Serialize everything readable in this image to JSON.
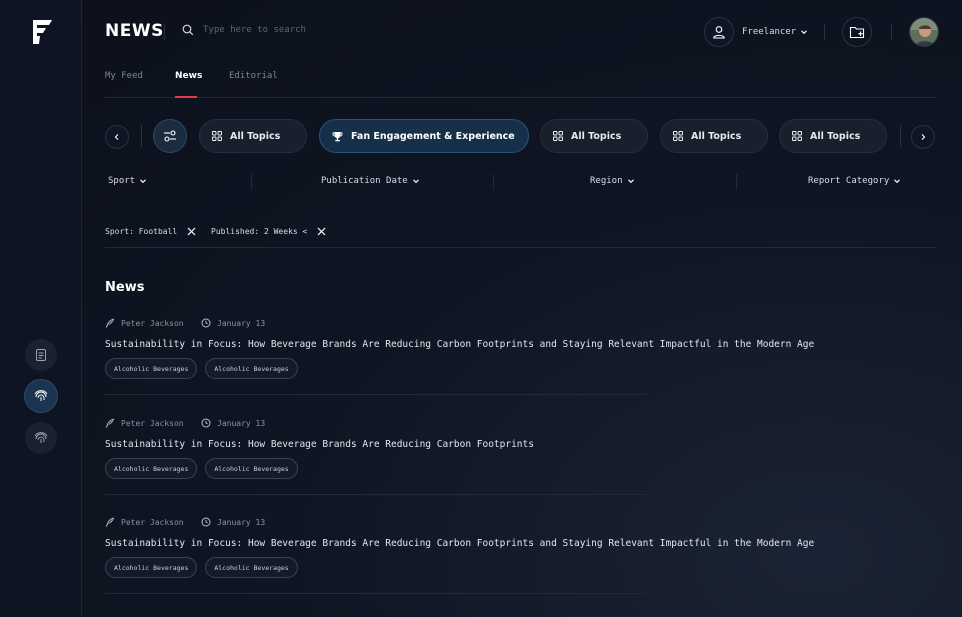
{
  "app": {
    "title": "NEWS"
  },
  "search": {
    "placeholder": "Type here to search"
  },
  "user": {
    "role": "Freelancer"
  },
  "tabs": [
    {
      "label": "My Feed",
      "active": false
    },
    {
      "label": "News",
      "active": true
    },
    {
      "label": "Editorial",
      "active": false
    }
  ],
  "chips": [
    {
      "label": "All Topics",
      "icon": "grid-icon",
      "active": false
    },
    {
      "label": "Fan Engagement & Experience",
      "icon": "trophy-icon",
      "active": true
    },
    {
      "label": "All Topics",
      "icon": "grid-icon",
      "active": false
    },
    {
      "label": "All Topics",
      "icon": "grid-icon",
      "active": false
    },
    {
      "label": "All Topics",
      "icon": "grid-icon",
      "active": false
    }
  ],
  "filters": [
    {
      "label": "Sport"
    },
    {
      "label": "Publication Date"
    },
    {
      "label": "Region"
    },
    {
      "label": "Report Category"
    }
  ],
  "applied_filters": [
    {
      "label": "Sport: Football"
    },
    {
      "label": "Published: 2 Weeks <"
    }
  ],
  "section": {
    "title": "News"
  },
  "articles": [
    {
      "author": "Peter Jackson",
      "date": "January 13",
      "title": "Sustainability in Focus: How Beverage Brands Are Reducing Carbon Footprints and Staying Relevant Impactful in the Modern Age",
      "tags": [
        "Alcoholic Beverages",
        "Alcoholic Beverages"
      ]
    },
    {
      "author": "Peter Jackson",
      "date": "January 13",
      "title": "Sustainability in Focus: How Beverage Brands Are Reducing Carbon Footprints",
      "tags": [
        "Alcoholic Beverages",
        "Alcoholic Beverages"
      ]
    },
    {
      "author": "Peter Jackson",
      "date": "January 13",
      "title": "Sustainability in Focus: How Beverage Brands Are Reducing Carbon Footprints and Staying Relevant Impactful in the Modern Age",
      "tags": [
        "Alcoholic Beverages",
        "Alcoholic Beverages"
      ]
    }
  ],
  "colors": {
    "accent": "#e23c4c",
    "active_chip": "#173049",
    "background": "#0f1523"
  }
}
